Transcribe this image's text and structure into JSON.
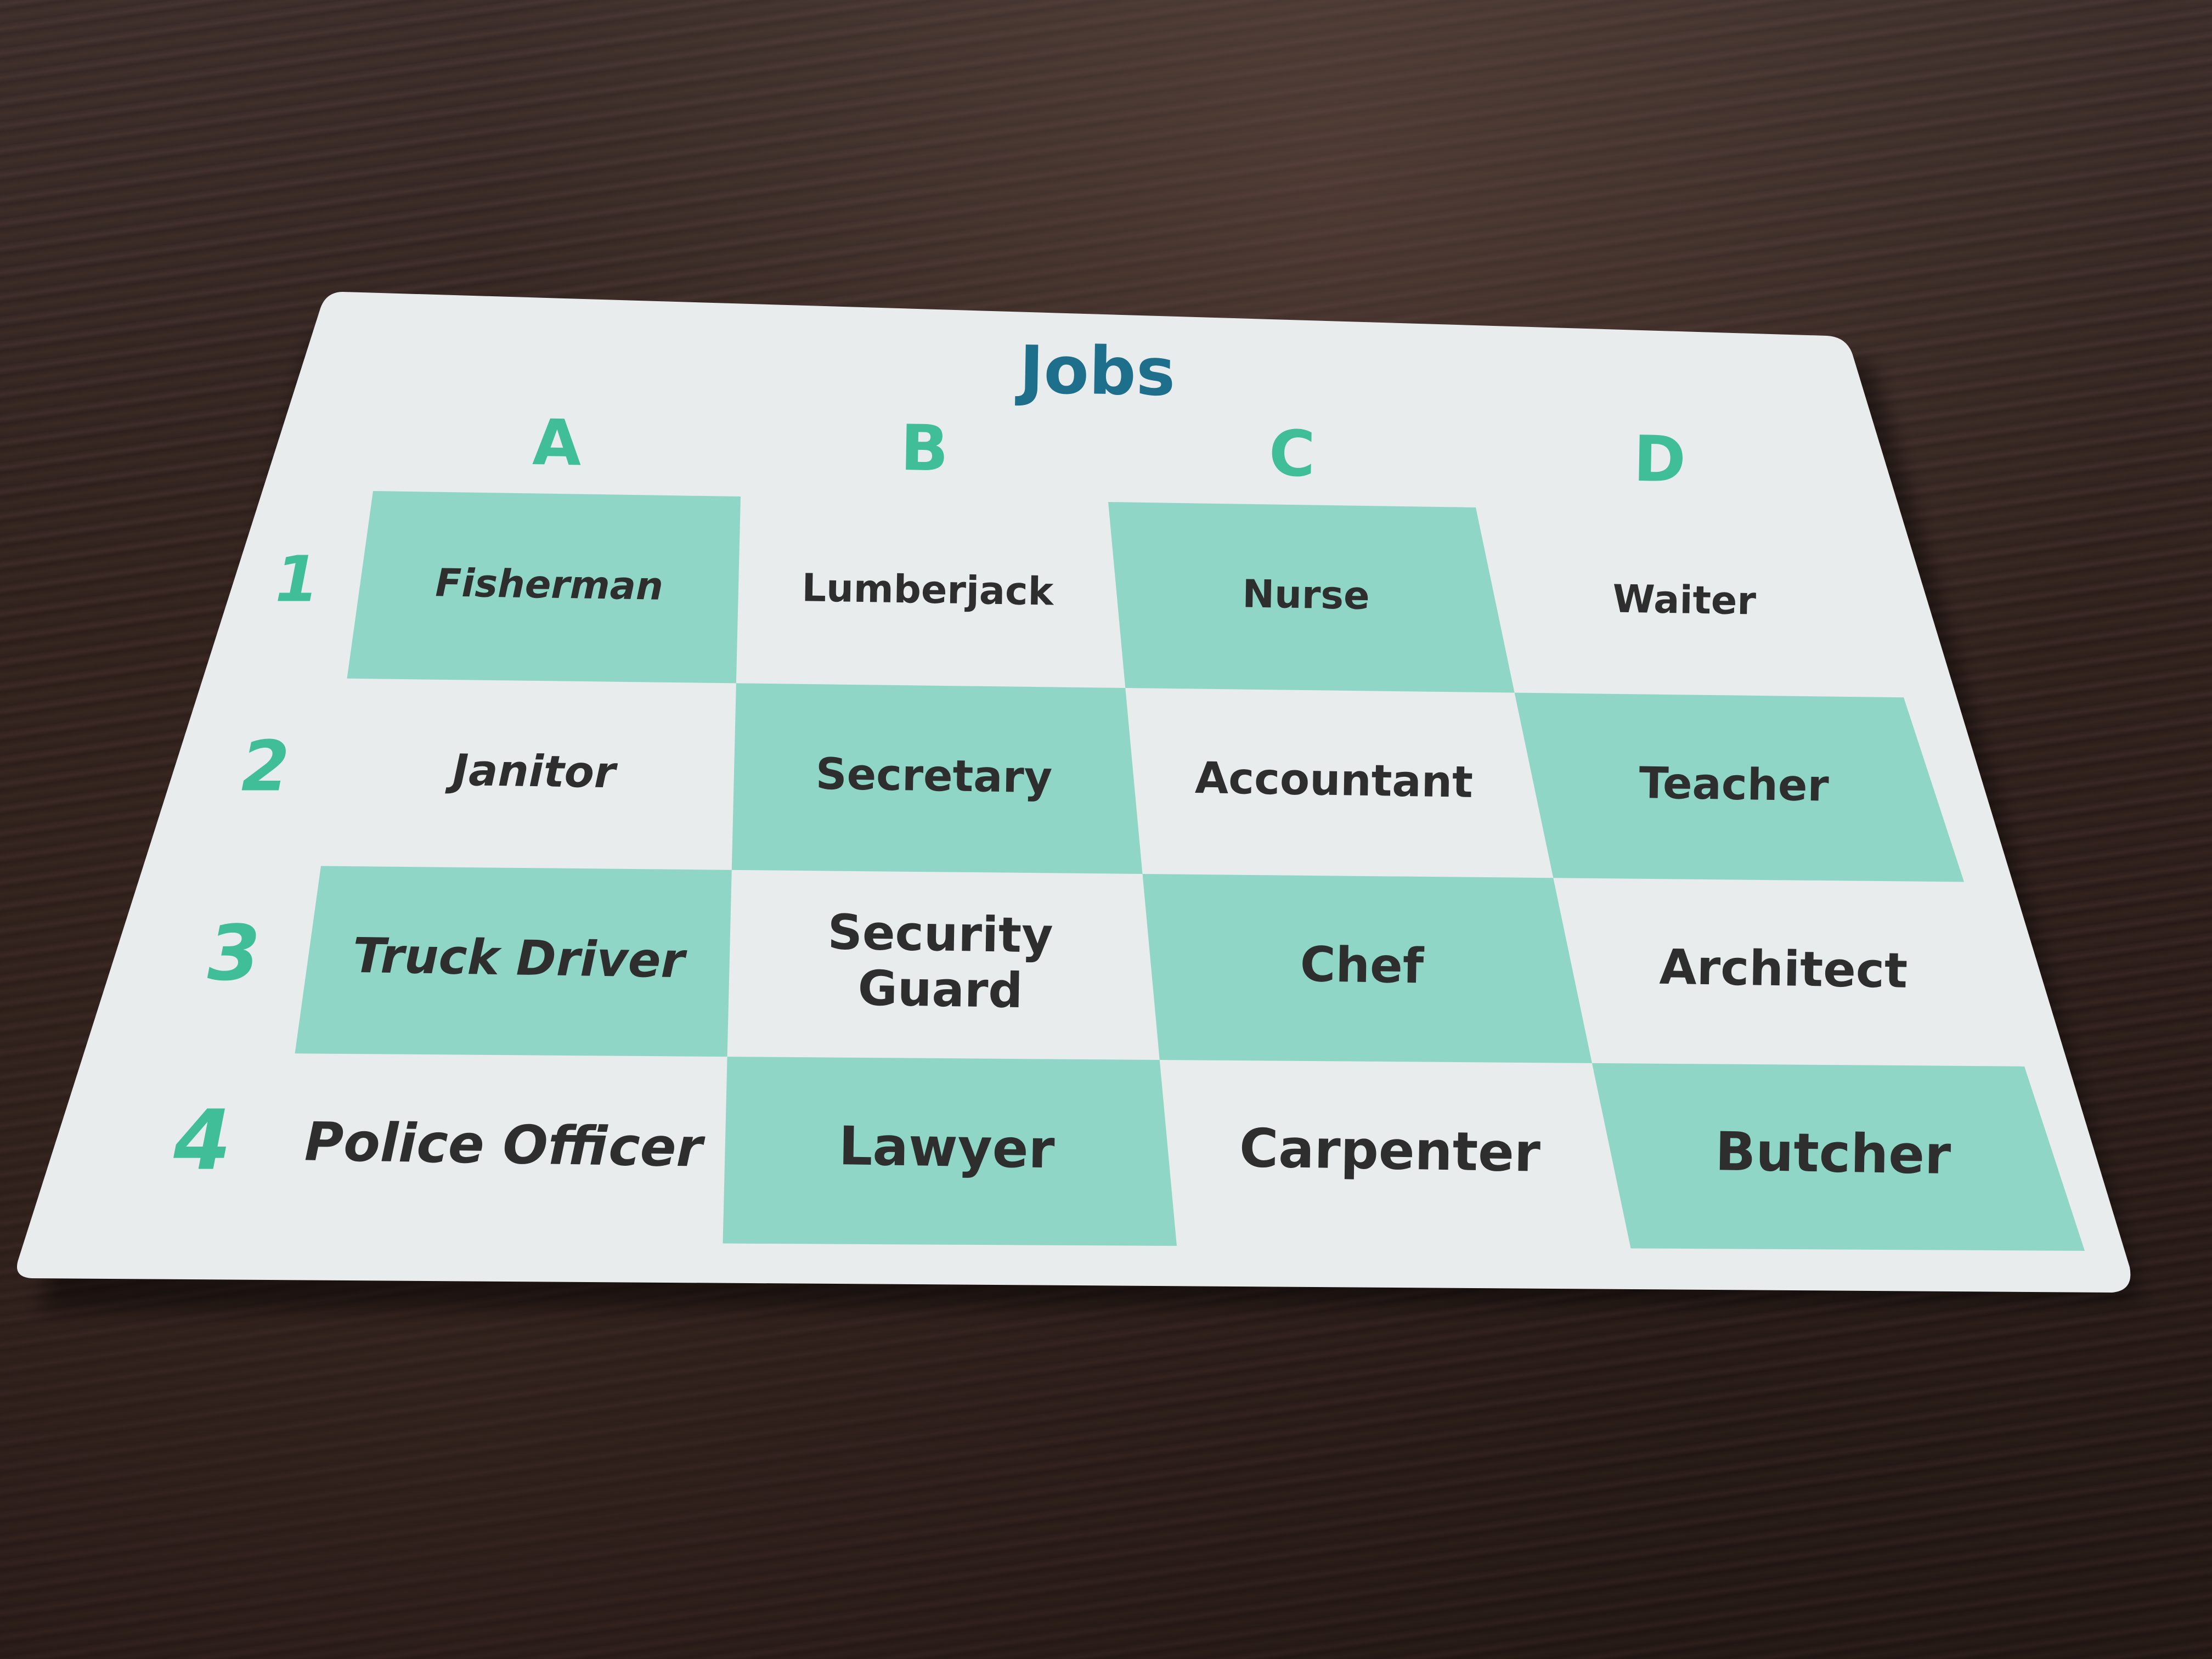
{
  "card": {
    "title": "Jobs",
    "columns": [
      "A",
      "B",
      "C",
      "D"
    ],
    "rows": [
      "1",
      "2",
      "3",
      "4"
    ],
    "cells": [
      [
        "Fisherman",
        "Lumberjack",
        "Nurse",
        "Waiter"
      ],
      [
        "Janitor",
        "Secretary",
        "Accountant",
        "Teacher"
      ],
      [
        "Truck Driver",
        [
          "Security",
          "Guard"
        ],
        "Chef",
        "Architect"
      ],
      [
        "Police Officer",
        "Lawyer",
        "Carpenter",
        "Butcher"
      ]
    ],
    "colors": {
      "card": "#e9ecec",
      "shaded_cell": "#8fd6c6",
      "label": "#3fbe98",
      "title": "#1d6f8c",
      "cell_text": "#2e2e2e"
    }
  }
}
